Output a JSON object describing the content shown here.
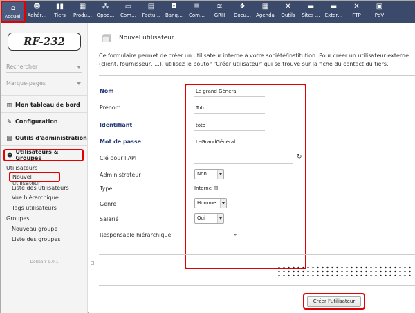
{
  "topbar": {
    "items": [
      {
        "label": "Accueil",
        "icon": "home-icon"
      },
      {
        "label": "Adhér…",
        "icon": "members-icon"
      },
      {
        "label": "Tiers",
        "icon": "thirdparty-icon"
      },
      {
        "label": "Produ…",
        "icon": "products-icon"
      },
      {
        "label": "Oppo…",
        "icon": "opportunities-icon"
      },
      {
        "label": "Com…",
        "icon": "commercial-icon"
      },
      {
        "label": "Factu…",
        "icon": "billing-icon"
      },
      {
        "label": "Banq…",
        "icon": "bank-icon"
      },
      {
        "label": "Com…",
        "icon": "accounting-icon"
      },
      {
        "label": "GRH",
        "icon": "hr-icon"
      },
      {
        "label": "Docu…",
        "icon": "documents-icon"
      },
      {
        "label": "Agenda",
        "icon": "agenda-icon"
      },
      {
        "label": "Outils",
        "icon": "tools-icon"
      },
      {
        "label": "Sites …",
        "icon": "websites-icon"
      },
      {
        "label": "Exter…",
        "icon": "external-icon"
      },
      {
        "label": "FTP",
        "icon": "ftp-icon"
      },
      {
        "label": "PdV",
        "icon": "pos-icon"
      }
    ]
  },
  "sidebar": {
    "logo": "RF-232",
    "search_label": "Rechercher",
    "bookmarks_label": "Marque-pages",
    "dashboard": "Mon tableau de bord",
    "configuration": "Configuration",
    "admin_tools": "Outils d'administration",
    "users_groups": "Utilisateurs & Groupes",
    "users_section": "Utilisateurs",
    "new_user": "Nouvel utilisateur",
    "user_list": "Liste des utilisateurs",
    "hierarchy": "Vue hiérarchique",
    "user_tags": "Tags utilisateurs",
    "groups_section": "Groupes",
    "new_group": "Nouveau groupe",
    "group_list": "Liste des groupes",
    "version": "Dolibarr 9.0.1"
  },
  "main": {
    "title": "Nouvel utilisateur",
    "description": "Ce formulaire permet de créer un utilisateur interne à votre société/institution. Pour créer un utilisateur externe (client, fournisseur, ...), utilisez le bouton 'Créer utilisateur' qui se trouve sur la fiche du contact du tiers.",
    "form": {
      "nom_label": "Nom",
      "nom_value": "Le grand Général",
      "prenom_label": "Prénom",
      "prenom_value": "Toto",
      "identifiant_label": "Identifiant",
      "identifiant_value": "toto",
      "password_label": "Mot de passe",
      "password_value": "LeGrandGénéral",
      "api_label": "Clé pour l'API",
      "api_value": "",
      "admin_label": "Administrateur",
      "admin_value": "Non",
      "type_label": "Type",
      "type_value": "Interne",
      "genre_label": "Genre",
      "genre_value": "Homme",
      "salarie_label": "Salarié",
      "salarie_value": "Oui",
      "responsable_label": "Responsable hiérarchique",
      "responsable_value": ""
    },
    "submit_label": "Créer l'utilisateur"
  }
}
